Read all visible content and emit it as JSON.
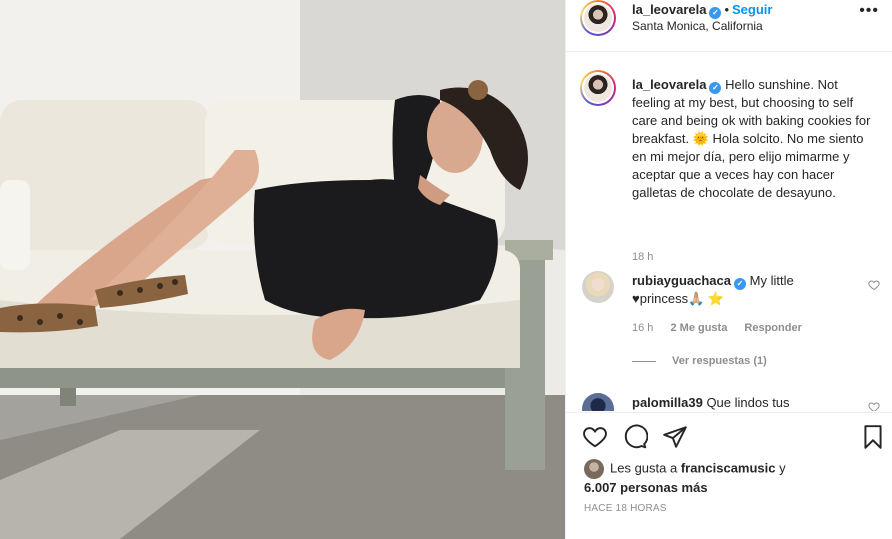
{
  "header": {
    "username": "la_leovarela",
    "follow_label": "Seguir",
    "separator": "•",
    "location": "Santa Monica, California",
    "more_label": "•••"
  },
  "caption": {
    "username": "la_leovarela",
    "text": "Hello sunshine. Not feeling at my best, but choosing to self care and being ok with baking cookies for breakfast. 🌞 Hola solcito. No me siento en mi mejor día, pero elijo mimarme y aceptar que a veces hay con hacer galletas de chocolate de desayuno.",
    "time": "18 h"
  },
  "comments": [
    {
      "username": "rubiayguachaca",
      "text": "My little ♥princess🙏🏼 ⭐",
      "time": "16 h",
      "likes": "2 Me gusta",
      "reply_label": "Responder",
      "view_replies": "Ver respuestas (1)"
    },
    {
      "username": "palomilla39",
      "text": "Que lindos tus"
    }
  ],
  "likes": {
    "prefix": "Les gusta a",
    "user": "franciscamusic",
    "connector": "y",
    "count": "6.007 personas más"
  },
  "time_ago": "HACE 18 HORAS",
  "icons": {
    "heart": "heart-icon",
    "comment": "comment-icon",
    "share": "share-icon",
    "save": "bookmark-icon",
    "verified": "verified-badge-icon"
  },
  "colors": {
    "accent": "#0095f6",
    "verified": "#3897f0",
    "muted": "#8e8e8e",
    "text": "#262626"
  }
}
